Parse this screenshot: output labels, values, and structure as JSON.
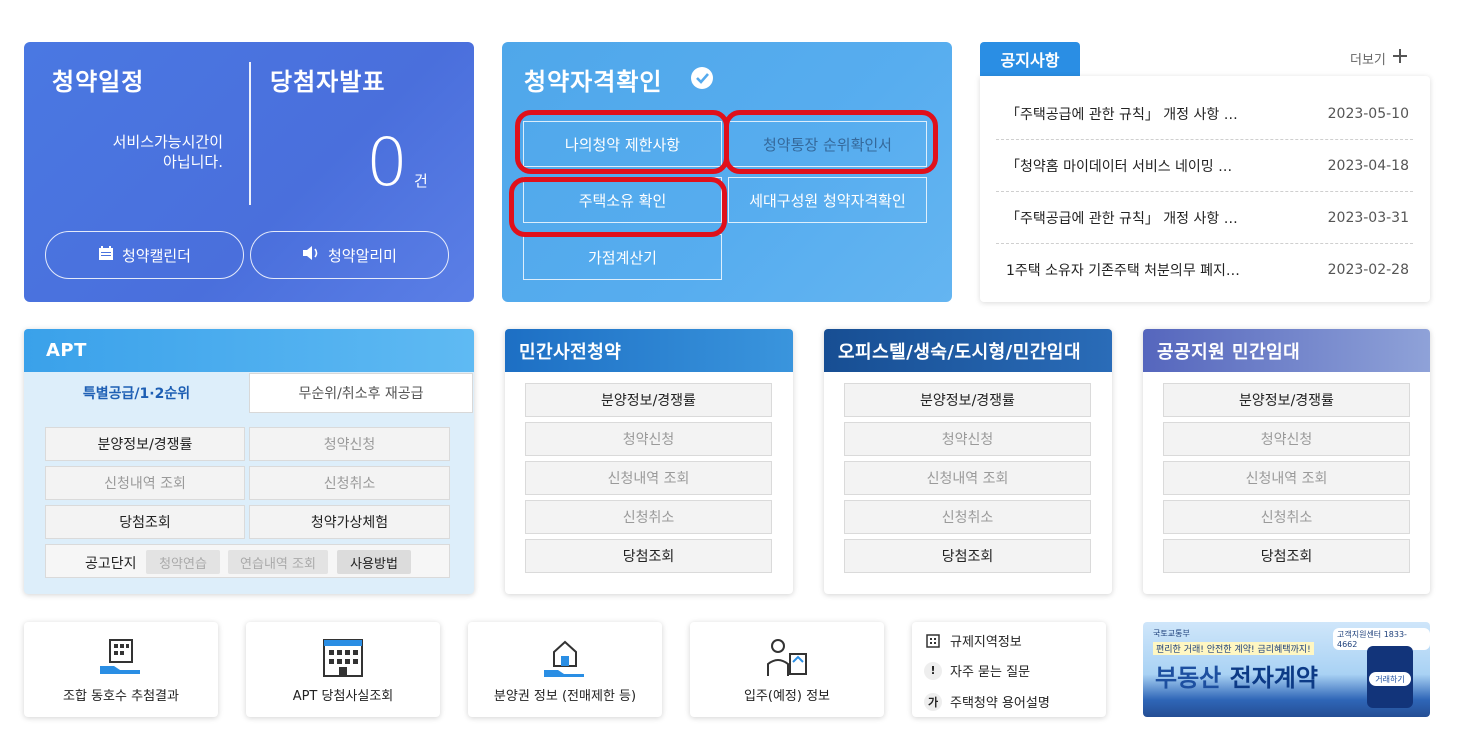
{
  "schedule": {
    "title": "청약일정",
    "message_line1": "서비스가능시간이",
    "message_line2": "아닙니다.",
    "winner_title": "당첨자발표",
    "winner_count": "0",
    "winner_unit": "건",
    "calendar_label": "청약캘린더",
    "alarm_label": "청약알리미"
  },
  "eligibility": {
    "title": "청약자격확인",
    "buttons": [
      "나의청약 제한사항",
      "청약통장 순위확인서",
      "주택소유 확인",
      "세대구성원 청약자격확인",
      "가점계산기"
    ]
  },
  "notice": {
    "tab": "공지사항",
    "more": "더보기",
    "items": [
      {
        "title": "「주택공급에 관한 규칙」 개정 사항 …",
        "date": "2023-05-10"
      },
      {
        "title": "「청약홈 마이데이터 서비스 네이밍 …",
        "date": "2023-04-18"
      },
      {
        "title": "「주택공급에 관한 규칙」 개정 사항 …",
        "date": "2023-03-31"
      },
      {
        "title": "1주택 소유자 기존주택 처분의무 폐지…",
        "date": "2023-02-28"
      }
    ]
  },
  "apt": {
    "title": "APT",
    "tab_active": "특별공급/1·2순위",
    "tab_inactive": "무순위/취소후 재공급",
    "buttons": [
      "분양정보/경쟁률",
      "청약신청",
      "신청내역 조회",
      "신청취소",
      "당첨조회",
      "청약가상체험"
    ],
    "complex_label": "공고단지",
    "chips": [
      "청약연습",
      "연습내역 조회",
      "사용방법"
    ]
  },
  "cards": [
    {
      "title": "민간사전청약",
      "buttons": [
        "분양정보/경쟁률",
        "청약신청",
        "신청내역 조회",
        "신청취소",
        "당첨조회"
      ]
    },
    {
      "title": "오피스텔/생숙/도시형/민간임대",
      "buttons": [
        "분양정보/경쟁률",
        "청약신청",
        "신청내역 조회",
        "신청취소",
        "당첨조회"
      ]
    },
    {
      "title": "공공지원 민간임대",
      "buttons": [
        "분양정보/경쟁률",
        "청약신청",
        "신청내역 조회",
        "신청취소",
        "당첨조회"
      ]
    }
  ],
  "tiles": [
    "조합 동호수 추첨결과",
    "APT 당첨사실조회",
    "분양권 정보 (전매제한 등)",
    "입주(예정) 정보"
  ],
  "links": [
    {
      "icon": "building-icon",
      "label": "규제지역정보"
    },
    {
      "icon": "exclamation-icon",
      "label": "자주 묻는 질문"
    },
    {
      "icon": "ga-icon",
      "label": "주택청약 용어설명"
    }
  ],
  "banner": {
    "org": "국토교통부",
    "tagline": "편리한 거래! 안전한 계약! 금리혜택까지!",
    "headline_part1": "부동산",
    "headline_part2": "전자계약",
    "button": "거래하기",
    "phone": "고객지원센터 1833-4662"
  },
  "colors": {
    "schedule_bg": "#4a73de",
    "eligibility_bg": "#55aaee",
    "notice_tab": "#2a8ee4",
    "highlight_red": "#e0101b"
  }
}
